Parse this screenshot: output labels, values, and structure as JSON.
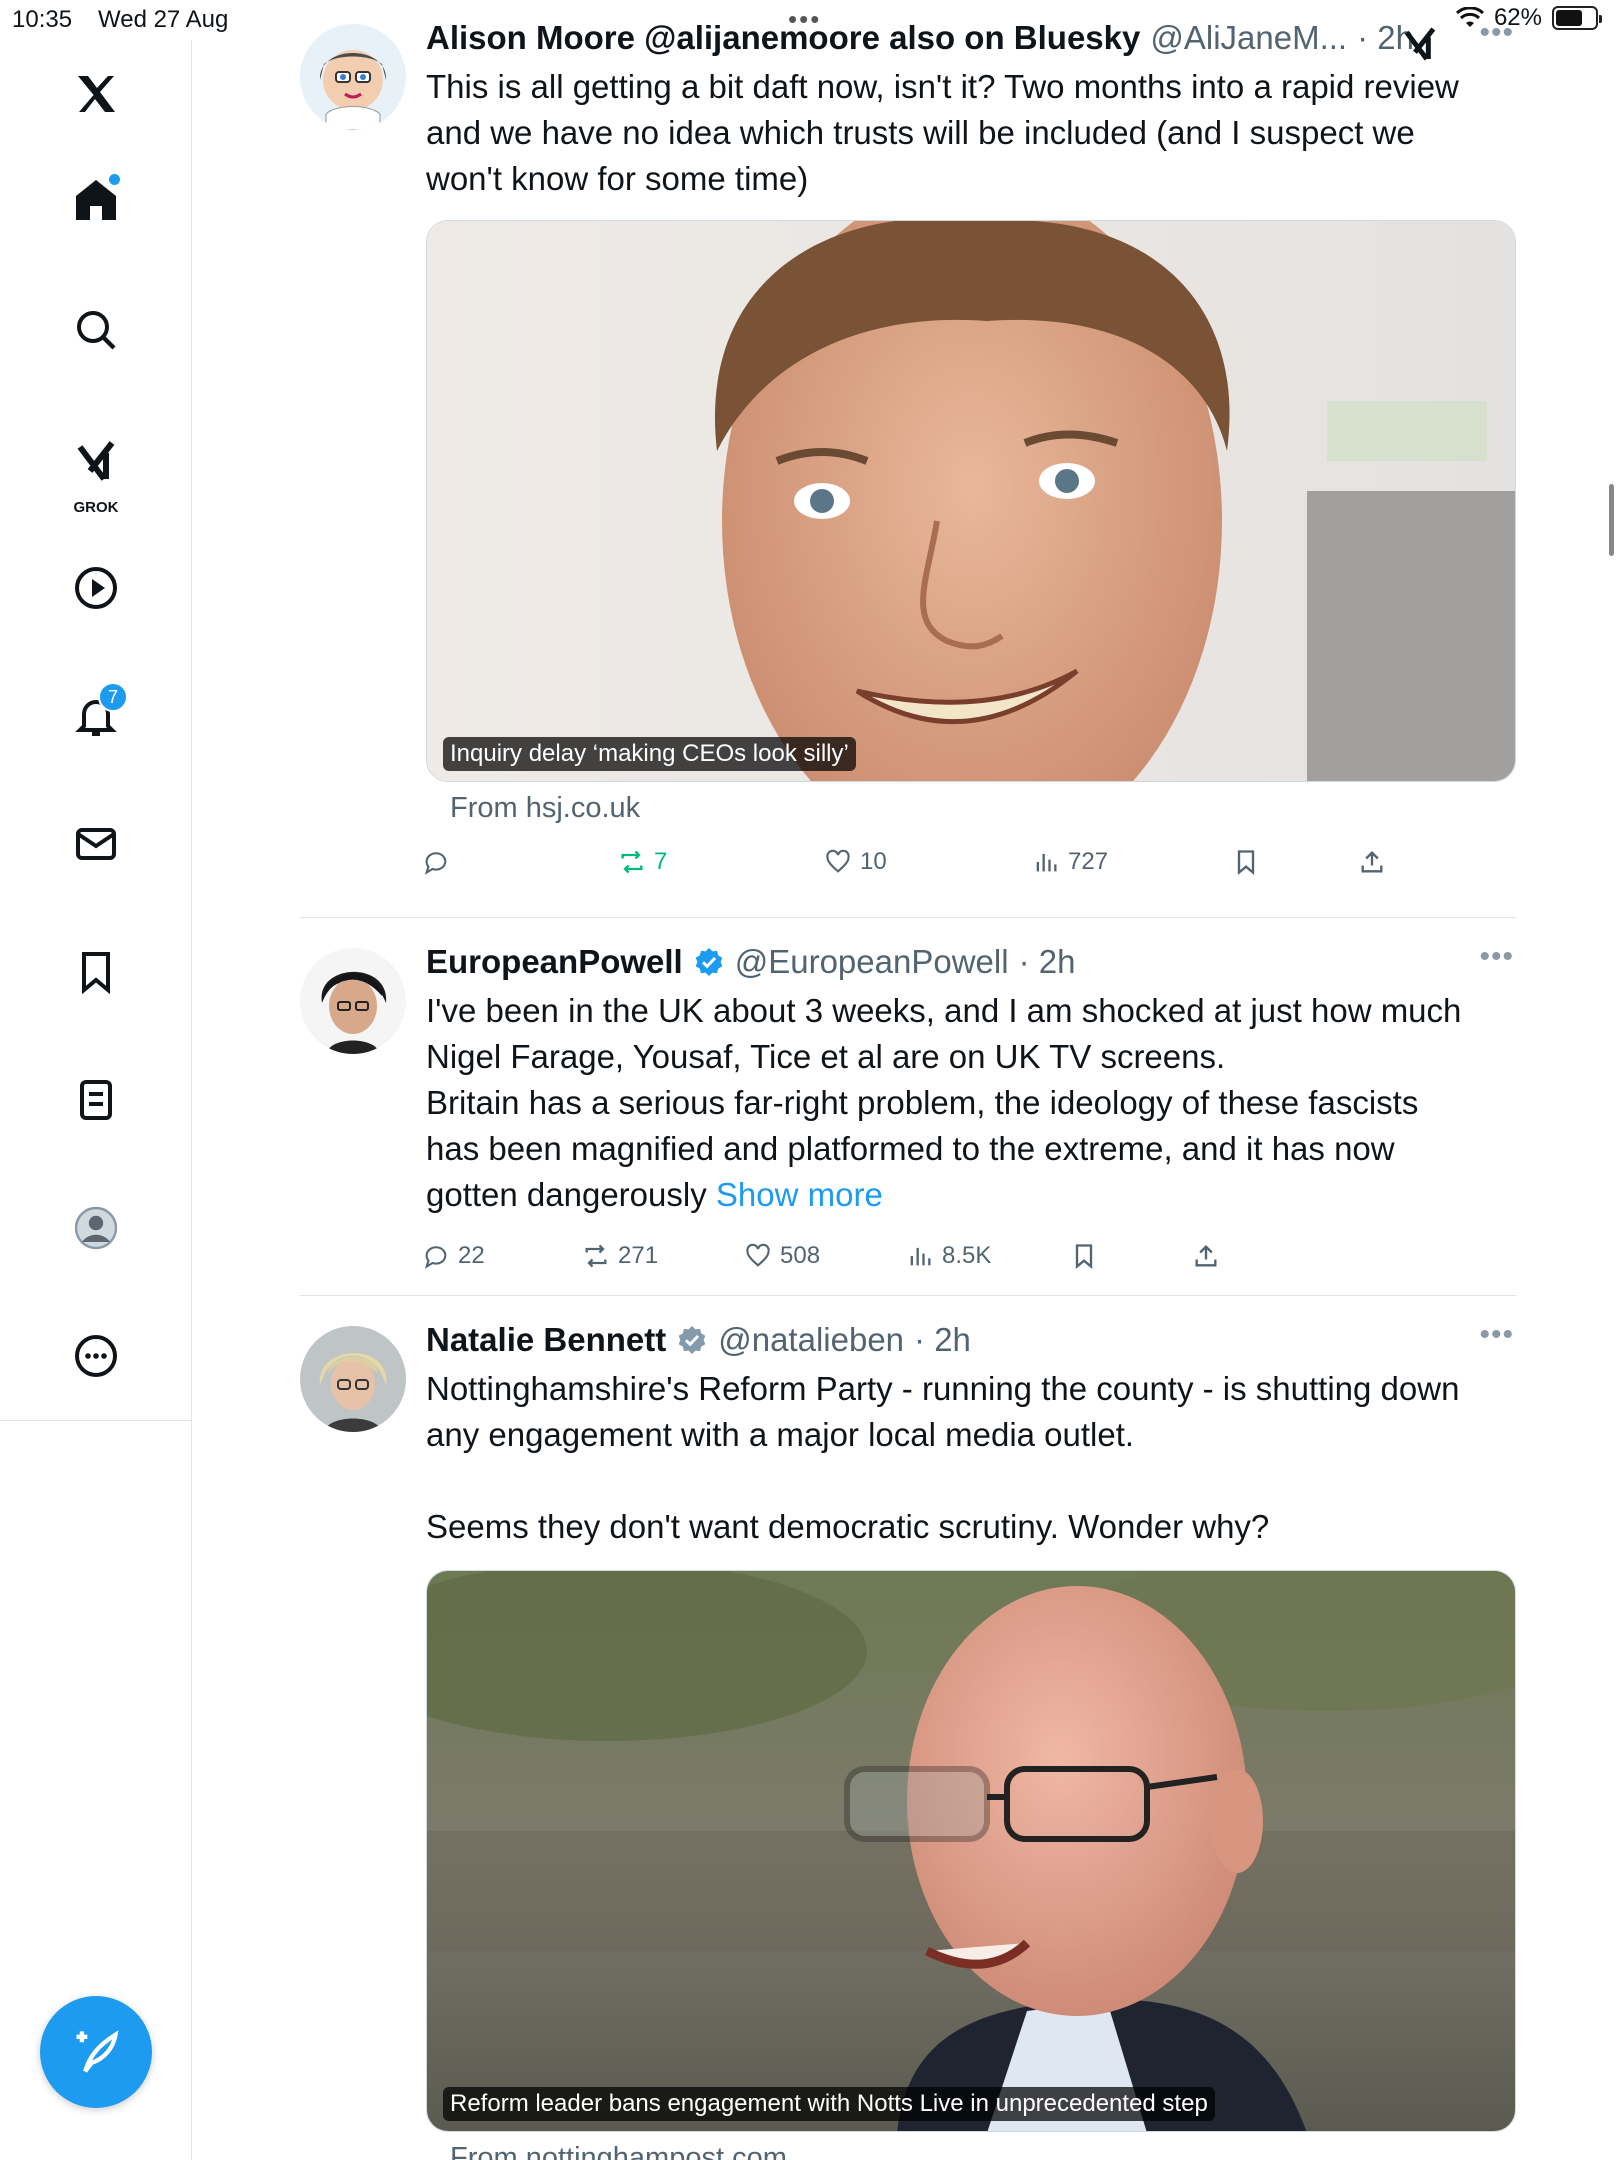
{
  "status": {
    "time": "10:35",
    "date": "Wed 27 Aug",
    "battery": "62%"
  },
  "sidebar": {
    "notifications_badge": "7",
    "grok_label": "GROK",
    "items": [
      "home",
      "explore",
      "grok",
      "video",
      "notifications",
      "messages",
      "bookmarks",
      "lists",
      "profile",
      "more"
    ]
  },
  "tweets": [
    {
      "name": "Alison Moore @alijanemoore also on Bluesky",
      "handle": "@AliJaneM...",
      "time": "· 2h",
      "text": [
        "This is all getting a bit daft now, isn't it? Two months into a rapid review",
        "and we have no idea which trusts will be included (and I suspect we",
        "won't know for some time)"
      ],
      "caption": "Inquiry delay ‘making CEOs look silly’",
      "source": "From hsj.co.uk",
      "stats": {
        "replies": "",
        "reposts": "7",
        "likes": "10",
        "views": "727"
      }
    },
    {
      "name": "EuropeanPowell",
      "handle": "@EuropeanPowell",
      "time": "· 2h",
      "text": [
        "I've been in the UK about 3 weeks, and I am shocked at just how much",
        "Nigel Farage, Yousaf, Tice et al are on UK TV screens.",
        "Britain has a serious far-right problem, the ideology of these fascists",
        "has been magnified and platformed to the extreme, and it has now"
      ],
      "last_line": "gotten dangerously",
      "show_more": "Show more",
      "stats": {
        "replies": "22",
        "reposts": "271",
        "likes": "508",
        "views": "8.5K"
      }
    },
    {
      "name": "Natalie Bennett",
      "handle": "@natalieben",
      "time": "· 2h",
      "text": [
        "Nottinghamshire's Reform Party - running the county - is shutting down",
        "any engagement with a major local media outlet.",
        "",
        "Seems they don't want democratic scrutiny. Wonder why?"
      ],
      "caption": "Reform leader bans engagement with Notts Live in unprecedented step",
      "source": "From nottinghampost.com"
    }
  ],
  "colors": {
    "accent": "#1d9bf0",
    "repost_active": "#00ba7c",
    "muted": "#536471"
  }
}
